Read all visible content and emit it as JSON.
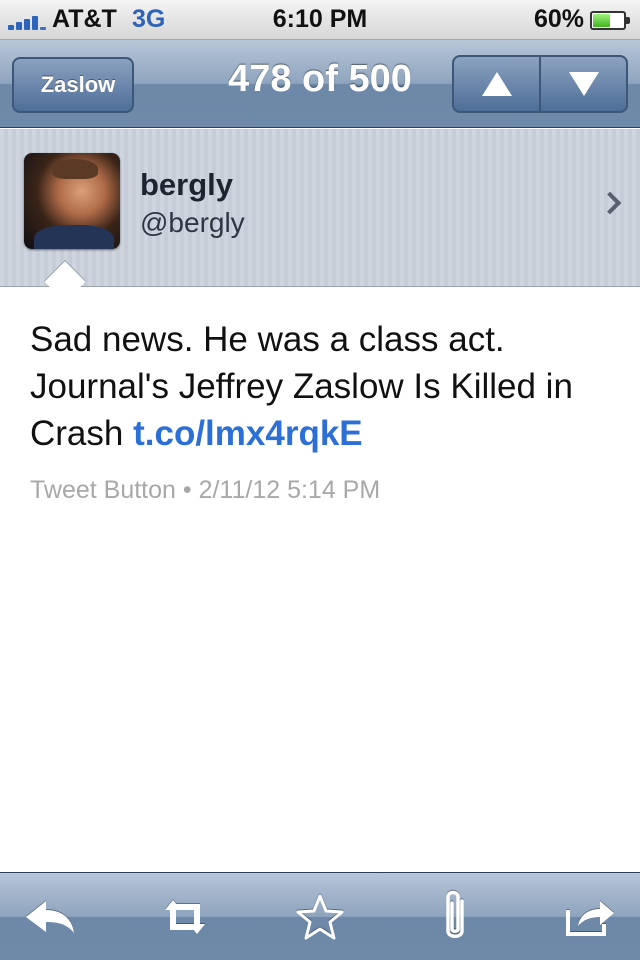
{
  "status_bar": {
    "carrier": "AT&T",
    "network": "3G",
    "time": "6:10 PM",
    "battery_percent": "60%",
    "battery_level": 0.6
  },
  "nav": {
    "back_label": "Zaslow",
    "title": "478 of 500",
    "up_icon": "up-arrow-icon",
    "down_icon": "down-arrow-icon"
  },
  "profile": {
    "name": "bergly",
    "handle": "@bergly"
  },
  "tweet": {
    "text": "Sad news. He was a class act. Journal's Jeffrey Zaslow Is Killed in Crash ",
    "link": "t.co/lmx4rqkE",
    "meta": "Tweet Button • 2/11/12 5:14 PM"
  },
  "toolbar": {
    "items": [
      "reply-icon",
      "retweet-icon",
      "favorite-star-icon",
      "attachment-paperclip-icon",
      "share-icon"
    ]
  },
  "colors": {
    "nav_blue": "#6f8aa9",
    "link_blue": "#2c6fd6",
    "meta_gray": "#a8a8a8"
  }
}
